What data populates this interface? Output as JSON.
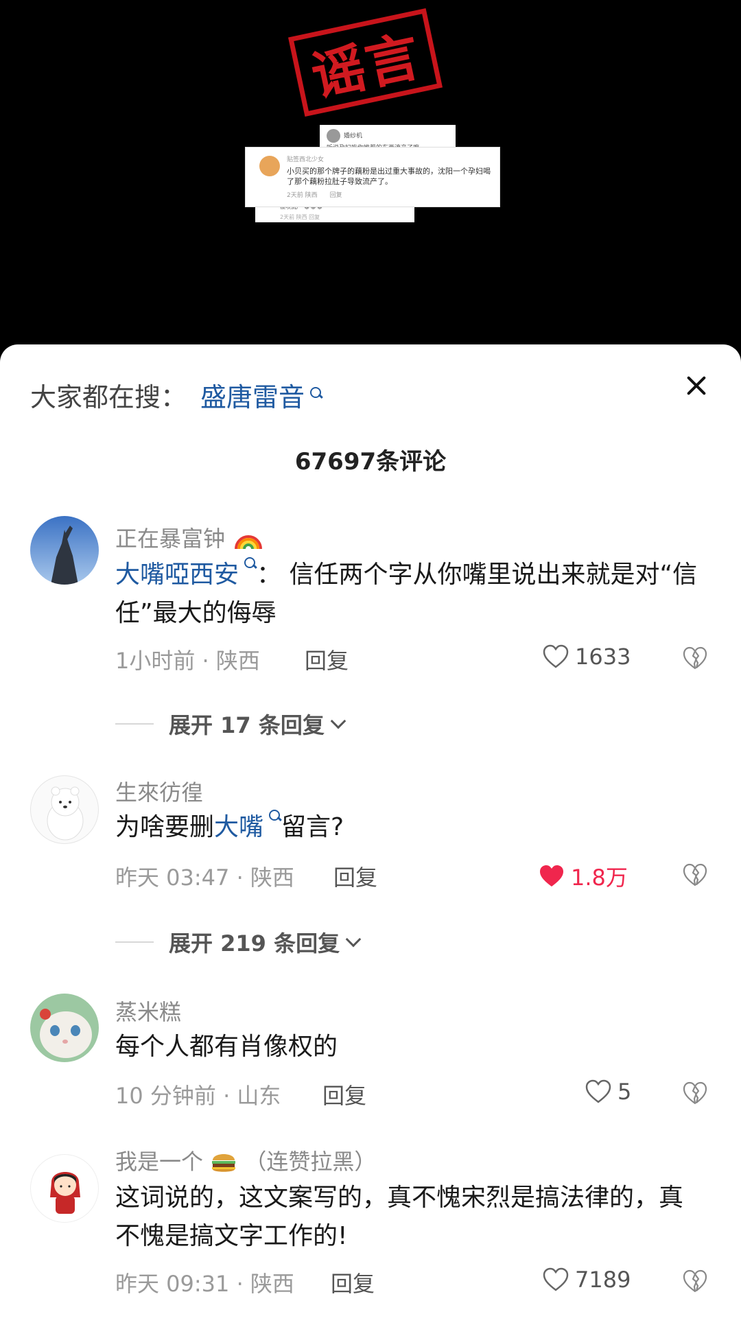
{
  "video": {
    "stamp_text": "谣言",
    "card_back_name": "婚纱机",
    "card_back_text": "听说孕妇吃你推荐的东西流产了嘛",
    "card_main_name": "贴签西北少女",
    "card_main_text": "小贝买的那个牌子的藕粉是出过重大事故的，沈阳一个孕妇喝了那个藕粉拉肚子导致流产了。",
    "card_main_time": "2天前 陕西",
    "card_main_reply": "回复",
    "card_small_text": "被喷流产 😂😂😂",
    "card_small_meta": "2天前 陕西   回复"
  },
  "header": {
    "search_prefix": "大家都在搜：",
    "search_term": "盛唐雷音",
    "comment_count": "67697条评论"
  },
  "comments": [
    {
      "username": "正在暴富钟",
      "link_text": "大嘴啞西安",
      "text_after": "：  信任两个字从你嘴里说出来就是对“信任”最大的侮辱",
      "meta": "1小时前 · 陕西",
      "reply": "回复",
      "likes": "1633",
      "liked": false,
      "expand": "展开 17 条回复"
    },
    {
      "username": "生來彷徨",
      "text_before": "为啥要删",
      "link_text": "大嘴",
      "text_after": "留言?",
      "meta": "昨天 03:47 · 陕西",
      "reply": "回复",
      "likes": "1.8万",
      "liked": true,
      "expand": "展开 219 条回复"
    },
    {
      "username": "蒸米糕",
      "text": "每个人都有肖像权的",
      "meta": "10 分钟前 · 山东",
      "reply": "回复",
      "likes": "5",
      "liked": false
    },
    {
      "username": "我是一个",
      "username_suffix": "（连赞拉黑）",
      "text": "这词说的，这文案写的，真不愧宋烈是搞法律的，真不愧是搞文字工作的!",
      "meta": "昨天 09:31 · 陕西",
      "reply": "回复",
      "likes": "7189",
      "liked": false
    }
  ],
  "icons": {
    "search": "search-icon",
    "close": "close-icon",
    "heart": "heart-icon",
    "dislike": "broken-heart-icon",
    "rainbow": "rainbow-emoji",
    "burger": "burger-emoji"
  },
  "colors": {
    "link": "#1f5aa1",
    "liked": "#f0264d",
    "stamp": "#c8141b"
  }
}
